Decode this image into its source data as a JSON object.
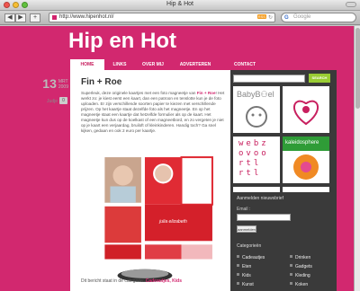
{
  "window": {
    "title": "Hip & Hot"
  },
  "toolbar": {
    "back": "◀",
    "forward": "▶",
    "url": "http://www.hipenhot.nl/",
    "rss": "RSS",
    "search_placeholder": "Google",
    "search_engine": "G"
  },
  "site": {
    "title": "Hip en Hot",
    "accent": "#d2286f",
    "menu": [
      "HOME",
      "LINKS",
      "OVER MIJ",
      "ADVERTEREN",
      "CONTACT"
    ]
  },
  "post": {
    "day": "13",
    "month": "MRT",
    "year": "2009",
    "author": "Judje",
    "comments": "0",
    "title": "Fin + Roe",
    "text_before": "Superleuk, deze originele kaartjes met een foto magneetje van ",
    "text_link": "Fin + Roe",
    "text_after": "! Het werkt zo: je kiest eerst een kaart, dan een patroon en tenslotte kun je de foto uploaden. Er zijn verschillende soorten papier te kiezen met verschillende prijzen. Op het kaartje staat dezelfde foto als het magneetje. En op het magneetje staat een kaartje dat hetzelfde formulier als op de kaart. Het magneetje kun dus op de koelkast of een magneetbord, en zo vergeten je niet op je kaart een verjaardag, bruiloft of kleinkinderen. Handig toch? Ga snel kijken, gedaan en ook 2 euro per kaartje.",
    "photo_card_text": "julia elizabeth",
    "footer_prefix": "Dit bericht staat in de categorie: ",
    "footer_categories": "Cadeautjes, Kids"
  },
  "sidebar": {
    "search_button": "SEARCH",
    "tiles": [
      {
        "label": "BabyB⚇el",
        "bg": "#ffffff",
        "fg": "#888888"
      },
      {
        "label": "",
        "bg": "#ffffff",
        "fg": "#c8205f"
      },
      {
        "label": "",
        "bg": "#ffffff",
        "fg": "#444444"
      },
      {
        "label": "",
        "bg": "#ffffff",
        "fg": "#c8205f"
      },
      {
        "label": "webz\novoo\nrtl\nrtl",
        "bg": "#ffffff",
        "fg": "#c8205f"
      },
      {
        "label": "kaleidosphere",
        "bg": "#55aa33",
        "fg": "#ffffff"
      }
    ],
    "newsletter_heading": "Aanmelden nieuwsbrief",
    "email_label": "Email :",
    "subscribe_button": "aanmelden",
    "categories_heading": "Categorieën",
    "categories": [
      "Cadeautjes",
      "Drinken",
      "Eten",
      "Gadgets",
      "Kids",
      "Kleding",
      "Kunst",
      "Koken"
    ]
  }
}
